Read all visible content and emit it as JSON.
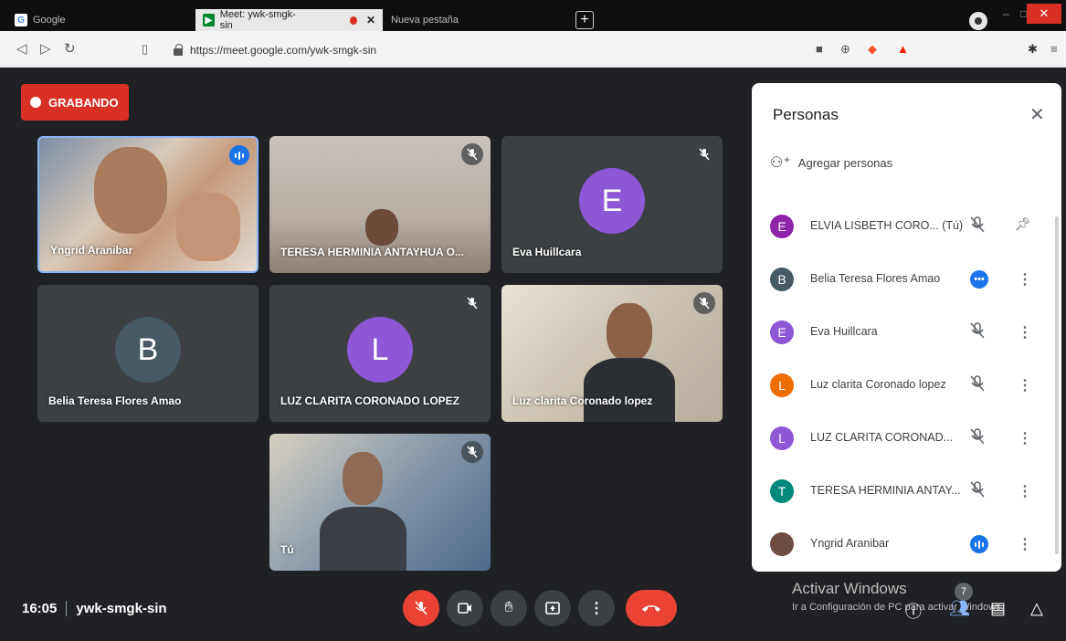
{
  "browser": {
    "tabs": [
      {
        "label": "Google",
        "active": false
      },
      {
        "label": "Meet: ywk-smgk-sin",
        "active": true
      },
      {
        "label": "Nueva pestaña",
        "active": false
      }
    ],
    "url": "https://meet.google.com/ywk-smgk-sin"
  },
  "recording": {
    "label": "GRABANDO"
  },
  "tiles": [
    {
      "name": "Yngrid Aranibar",
      "type": "video",
      "speaking": true
    },
    {
      "name": "TERESA HERMINIA ANTAYHUA O...",
      "type": "video",
      "muted": true
    },
    {
      "name": "Eva Huillcara",
      "type": "avatar",
      "initial": "E",
      "color": "#8e57d6",
      "muted": true
    },
    {
      "name": "Belia Teresa Flores Amao",
      "type": "avatar",
      "initial": "B",
      "color": "#455a64"
    },
    {
      "name": "LUZ CLARITA CORONADO LOPEZ",
      "type": "avatar",
      "initial": "L",
      "color": "#8e57d6",
      "muted": true
    },
    {
      "name": "Luz clarita Coronado lopez",
      "type": "video",
      "muted": true
    },
    {
      "name": "Tú",
      "type": "video",
      "muted": true
    }
  ],
  "panel": {
    "title": "Personas",
    "add_people": "Agregar personas",
    "people": [
      {
        "name": "ELVIA LISBETH CORO... (Tú)",
        "initial": "E",
        "color": "#8e24aa",
        "status": "muted",
        "action": "pin"
      },
      {
        "name": "Belia Teresa Flores Amao",
        "initial": "B",
        "color": "#455a64",
        "status": "more"
      },
      {
        "name": "Eva Huillcara",
        "initial": "E",
        "color": "#8e57d6",
        "status": "muted"
      },
      {
        "name": "Luz clarita Coronado lopez",
        "initial": "L",
        "color": "#ef6c00",
        "status": "muted"
      },
      {
        "name": "LUZ CLARITA CORONAD...",
        "initial": "L",
        "color": "#8e57d6",
        "status": "muted"
      },
      {
        "name": "TERESA HERMINIA ANTAY...",
        "initial": "T",
        "color": "#00897b",
        "status": "muted"
      },
      {
        "name": "Yngrid Aranibar",
        "initial": "",
        "color": "#6d4c41",
        "status": "speaking"
      }
    ]
  },
  "bottom": {
    "time": "16:05",
    "meeting_code": "ywk-smgk-sin",
    "participants_count": "7"
  },
  "watermark": {
    "line1": "Activar Windows",
    "line2": "Ir a Configuración de PC para activar Windows."
  }
}
